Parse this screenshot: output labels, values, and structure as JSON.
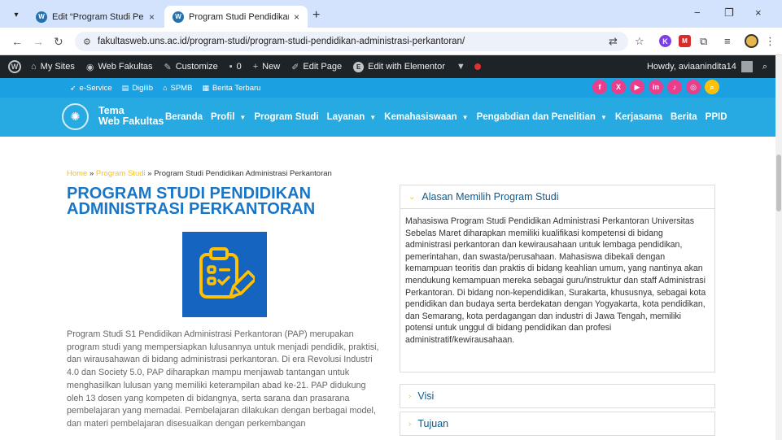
{
  "browser": {
    "tabs": [
      {
        "title": "Edit “Program Studi Pendidikan",
        "active": false
      },
      {
        "title": "Program Studi Pendidikan Adm",
        "active": true
      }
    ],
    "url": "fakultasweb.uns.ac.id/program-studi/program-studi-pendidikan-administrasi-perkantoran/",
    "new_tab": "+",
    "close_glyph": "×",
    "window": {
      "minimize": "−",
      "restore": "❐",
      "close": "×"
    },
    "ext_k": "K",
    "ext_m": "M"
  },
  "adminbar": {
    "wp_logo": "W",
    "items": [
      {
        "label": "My Sites",
        "icon": "home-icon"
      },
      {
        "label": "Web Fakultas",
        "icon": "dashboard-icon"
      },
      {
        "label": "Customize",
        "icon": "brush-icon"
      },
      {
        "label": "0",
        "icon": "comment-icon"
      },
      {
        "label": "New",
        "icon": "plus-icon"
      },
      {
        "label": "Edit Page",
        "icon": "pencil-icon"
      },
      {
        "label": "Edit with Elementor",
        "icon": "elementor-icon"
      }
    ],
    "elementor_glyph": "E",
    "howdy": "Howdy, aviaanindita14"
  },
  "topbar": {
    "links": [
      {
        "label": "e-Service",
        "icon": "rocket-icon"
      },
      {
        "label": "Digilib",
        "icon": "book-icon"
      },
      {
        "label": "SPMB",
        "icon": "building-icon"
      },
      {
        "label": "Berita Terbaru",
        "icon": "newspaper-icon"
      }
    ],
    "social": [
      "f",
      "X",
      "▶",
      "in",
      "♪",
      "◎"
    ]
  },
  "nav": {
    "brand_line1": "Tema",
    "brand_line2": "Web Fakultas",
    "items": [
      {
        "label": "Beranda",
        "dropdown": false
      },
      {
        "label": "Profil",
        "dropdown": true
      },
      {
        "label": "Program Studi",
        "dropdown": false
      },
      {
        "label": "Layanan",
        "dropdown": true
      },
      {
        "label": "Kemahasiswaan",
        "dropdown": true
      },
      {
        "label": "Pengabdian dan Penelitian",
        "dropdown": true
      },
      {
        "label": "Kerjasama",
        "dropdown": false
      },
      {
        "label": "Berita",
        "dropdown": false
      },
      {
        "label": "PPID",
        "dropdown": false
      }
    ]
  },
  "breadcrumb": {
    "home": "Home",
    "sep": " » ",
    "parent": "Program Studi",
    "current": "Program Studi Pendidikan Administrasi Perkantoran"
  },
  "page": {
    "title": "Program Studi Pendidikan Administrasi Perkantoran",
    "intro": "Program Studi S1 Pendidikan Administrasi Perkantoran (PAP) merupakan program studi yang mempersiapkan lulusannya untuk menjadi pendidik, praktisi, dan wirausahawan di bidang administrasi perkantoran. Di era Revolusi Industri 4.0 dan Society 5.0, PAP diharapkan mampu menjawab tantangan untuk menghasilkan lulusan yang memiliki keterampilan abad ke-21. PAP didukung oleh 13 dosen yang kompeten di bidangnya, serta sarana dan prasarana pembelajaran yang memadai. Pembelajaran dilakukan dengan berbagai model, dan materi pembelajaran disesuaikan dengan perkembangan"
  },
  "accordion": [
    {
      "title": "Alasan Memilih Program Studi",
      "open": true,
      "body": "Mahasiswa Program Studi Pendidikan Administrasi Perkantoran Universitas Sebelas Maret diharapkan memiliki kualifikasi kompetensi di bidang administrasi perkantoran dan kewirausahaan untuk lembaga pendidikan, pemerintahan, dan swasta/perusahaan. Mahasiswa dibekali dengan kemampuan teoritis dan praktis di bidang keahlian umum, yang nantinya akan mendukung kemampuan mereka sebagai guru/instruktur dan staff Administrasi Perkantoran. Di bidang non-kependidikan, Surakarta, khususnya, sebagai kota pendidikan dan budaya serta berdekatan dengan Yogyakarta, kota pendidikan, dan Semarang, kota perdagangan dan industri di Jawa Tengah, memiliki potensi untuk unggul di bidang pendidikan dan profesi administratif/kewirausahaan."
    },
    {
      "title": "Visi",
      "open": false
    },
    {
      "title": "Tujuan",
      "open": false
    }
  ],
  "colors": {
    "adminbar": "#1d2327",
    "topbar": "#1ba1e2",
    "nav": "#27a9e1",
    "title": "#1976c7",
    "accent": "#ffc107",
    "social": "#e83e8c",
    "illustration": "#1565c0"
  }
}
